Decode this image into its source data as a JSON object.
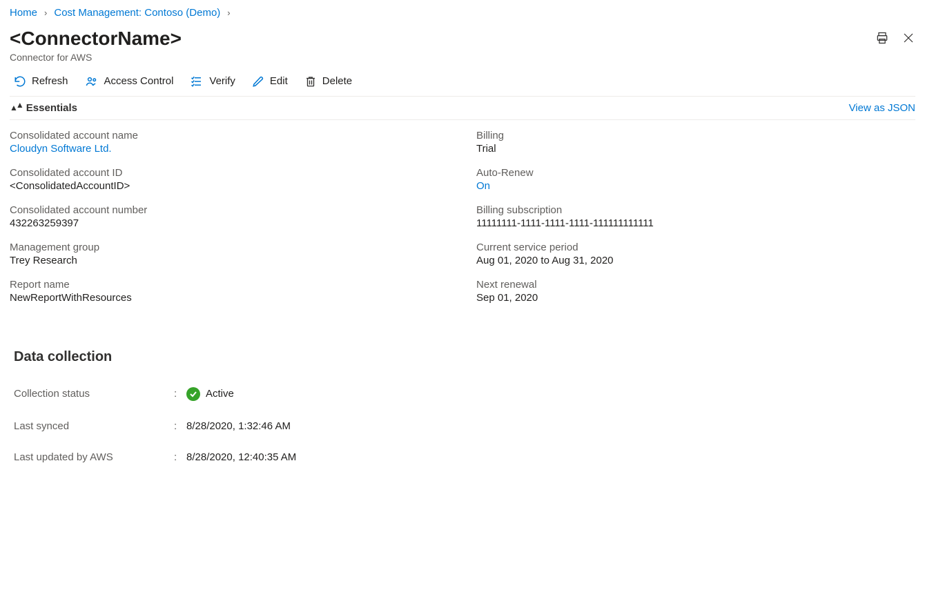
{
  "breadcrumb": {
    "home": "Home",
    "cost_mgmt": "Cost Management: Contoso (Demo)"
  },
  "header": {
    "title": "<ConnectorName>",
    "subtitle": "Connector for AWS"
  },
  "toolbar": {
    "refresh": "Refresh",
    "access_control": "Access Control",
    "verify": "Verify",
    "edit": "Edit",
    "delete": "Delete"
  },
  "essentials": {
    "label": "Essentials",
    "view_json": "View as JSON",
    "left": [
      {
        "label": "Consolidated account name",
        "value": "Cloudyn Software Ltd.",
        "link": true
      },
      {
        "label": "Consolidated account ID",
        "value": "<ConsolidatedAccountID>",
        "link": false
      },
      {
        "label": "Consolidated account number",
        "value": "432263259397",
        "link": false
      },
      {
        "label": "Management group",
        "value": "Trey Research",
        "link": false
      },
      {
        "label": "Report name",
        "value": "NewReportWithResources",
        "link": false
      }
    ],
    "right": [
      {
        "label": "Billing",
        "value": "Trial",
        "link": false
      },
      {
        "label": "Auto-Renew",
        "value": "On",
        "link": true
      },
      {
        "label": "Billing subscription",
        "value": "11111111-1111-1111-1111-111111111111",
        "link": false
      },
      {
        "label": "Current service period",
        "value": "Aug 01, 2020 to Aug 31, 2020",
        "link": false
      },
      {
        "label": "Next renewal",
        "value": "Sep 01, 2020",
        "link": false
      }
    ]
  },
  "data_collection": {
    "heading": "Data collection",
    "rows": {
      "collection_status": {
        "label": "Collection status",
        "value": "Active"
      },
      "last_synced": {
        "label": "Last synced",
        "value": "8/28/2020, 1:32:46 AM"
      },
      "last_updated": {
        "label": "Last updated by AWS",
        "value": "8/28/2020, 12:40:35 AM"
      }
    }
  }
}
